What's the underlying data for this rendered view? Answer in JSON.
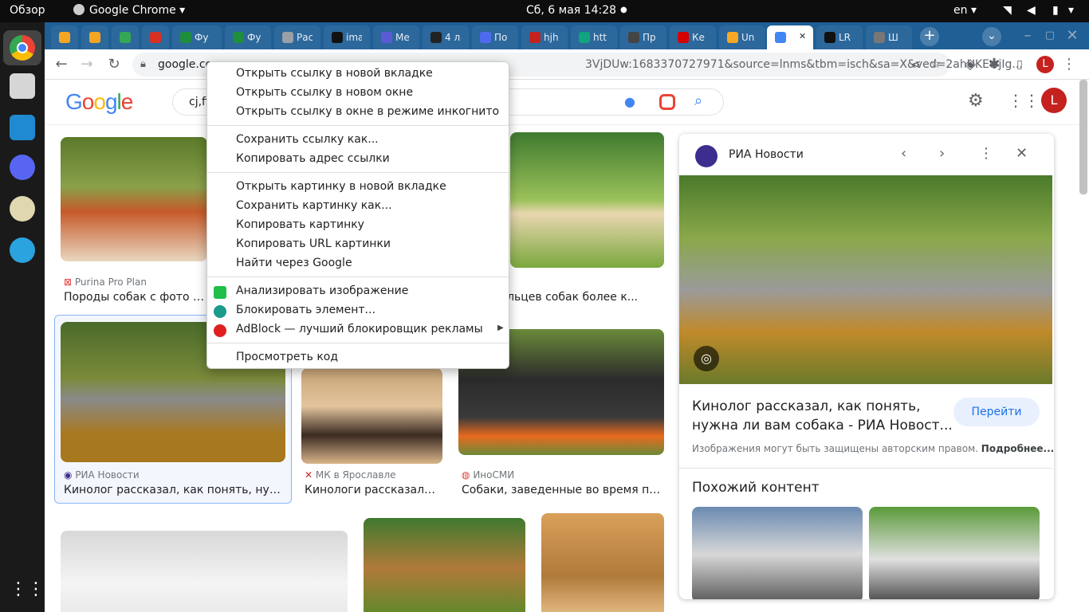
{
  "topbar": {
    "overview": "Обзор",
    "app": "Google Chrome",
    "clock": "Сб, 6 мая  14:28",
    "lang": "en"
  },
  "tabs": [
    {
      "label": "",
      "color": "#f4a623"
    },
    {
      "label": "",
      "color": "#f4a623"
    },
    {
      "label": "",
      "color": "#34a853"
    },
    {
      "label": "",
      "color": "#d93025"
    },
    {
      "label": "Фу",
      "color": "#1e8e3e"
    },
    {
      "label": "Фу",
      "color": "#1e8e3e"
    },
    {
      "label": "Рас",
      "color": "#9aa0a6"
    },
    {
      "label": "ima",
      "color": "#111111"
    },
    {
      "label": "Me",
      "color": "#5b5bd6"
    },
    {
      "label": "4 л",
      "color": "#222222"
    },
    {
      "label": "По",
      "color": "#4f6bed"
    },
    {
      "label": "hjh",
      "color": "#c5221f"
    },
    {
      "label": "htt",
      "color": "#10a37f"
    },
    {
      "label": "Пр",
      "color": "#444444"
    },
    {
      "label": "Ке",
      "color": "#d50000"
    },
    {
      "label": "Un",
      "color": "#f9a825"
    },
    {
      "label": "",
      "color": "#4285f4"
    },
    {
      "label": "LR",
      "color": "#111111"
    },
    {
      "label": "Ш",
      "color": "#777777"
    }
  ],
  "omnibox": {
    "url_left": "google.co",
    "url_right": "3VjDUw:1683370727971&source=lnms&tbm=isch&sa=X&ved=2ahUKEwjIg..."
  },
  "search": {
    "query": "cj,ff"
  },
  "results": [
    {
      "source": "Purina Pro Plan",
      "title": "Породы собак с фото и наз"
    },
    {
      "source": "",
      "title": "владельцев собак более к..."
    },
    {
      "source": "РИА Новости",
      "title": "Кинолог рассказал, как понять, нужна л..."
    },
    {
      "source": "МК в Ярославле",
      "title": "Кинологи рассказали, ч..."
    },
    {
      "source": "ИноСМИ",
      "title": "Собаки, заведенные во время панд..."
    }
  ],
  "panel": {
    "source": "РИА Новости",
    "title_line1": "Кинолог рассказал, как понять,",
    "title_line2": "нужна ли вам собака - РИА Новост...",
    "visit": "Перейти",
    "copyright": "Изображения могут быть защищены авторским правом.",
    "more": "Подробнее...",
    "related": "Похожий контент"
  },
  "context_menu": {
    "items": [
      "Открыть ссылку в новой вкладке",
      "Открыть ссылку в новом окне",
      "Открыть ссылку в окне в режиме инкогнито",
      "Сохранить ссылку как...",
      "Копировать адрес ссылки",
      "Открыть картинку в новой вкладке",
      "Сохранить картинку как...",
      "Копировать картинку",
      "Копировать URL картинки",
      "Найти через Google",
      "Анализировать изображение",
      "Блокировать элемент...",
      "AdBlock — лучший блокировщик рекламы",
      "Просмотреть код"
    ]
  },
  "profile_initial": "L"
}
